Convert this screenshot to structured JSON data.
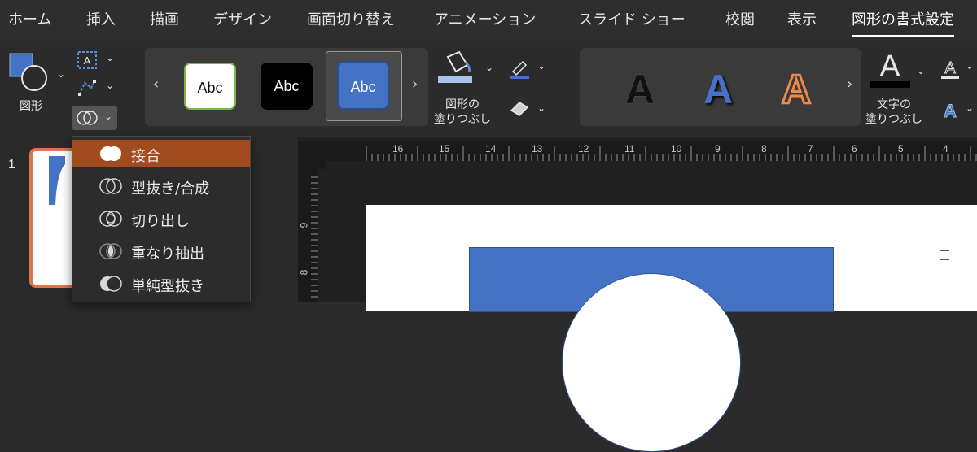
{
  "tabs": [
    {
      "label": "ホーム",
      "active": false
    },
    {
      "label": "挿入",
      "active": false
    },
    {
      "label": "描画",
      "active": false
    },
    {
      "label": "デザイン",
      "active": false
    },
    {
      "label": "画面切り替え",
      "active": false
    },
    {
      "label": "アニメーション",
      "active": false
    },
    {
      "label": "スライド ショー",
      "active": false
    },
    {
      "label": "校閲",
      "active": false
    },
    {
      "label": "表示",
      "active": false
    },
    {
      "label": "図形の書式設定",
      "active": true
    }
  ],
  "ribbon": {
    "shapes_label": "図形",
    "shape_styles": [
      "Abc",
      "Abc",
      "Abc"
    ],
    "fill_label_line1": "図形の",
    "fill_label_line2": "塗りつぶし",
    "wordart_letters": [
      "A",
      "A",
      "A"
    ],
    "text_fill_line1": "文字の",
    "text_fill_line2": "塗りつぶし"
  },
  "colors": {
    "accent_blue": "#4472c4",
    "menu_highlight": "#a24b1f",
    "wordart_orange": "#f08a4b"
  },
  "slide_panel": {
    "slide_number": "1"
  },
  "ruler": {
    "horizontal_labels": [
      "16",
      "15",
      "14",
      "13",
      "12",
      "11",
      "10",
      "9",
      "8",
      "7",
      "6",
      "5",
      "4"
    ],
    "vertical_labels": [
      "9",
      "8"
    ]
  },
  "merge_menu": {
    "items": [
      {
        "label": "接合",
        "icon": "union-icon",
        "selected": true
      },
      {
        "label": "型抜き/合成",
        "icon": "combine-icon",
        "selected": false
      },
      {
        "label": "切り出し",
        "icon": "fragment-icon",
        "selected": false
      },
      {
        "label": "重なり抽出",
        "icon": "intersect-icon",
        "selected": false
      },
      {
        "label": "単純型抜き",
        "icon": "subtract-icon",
        "selected": false
      }
    ]
  }
}
